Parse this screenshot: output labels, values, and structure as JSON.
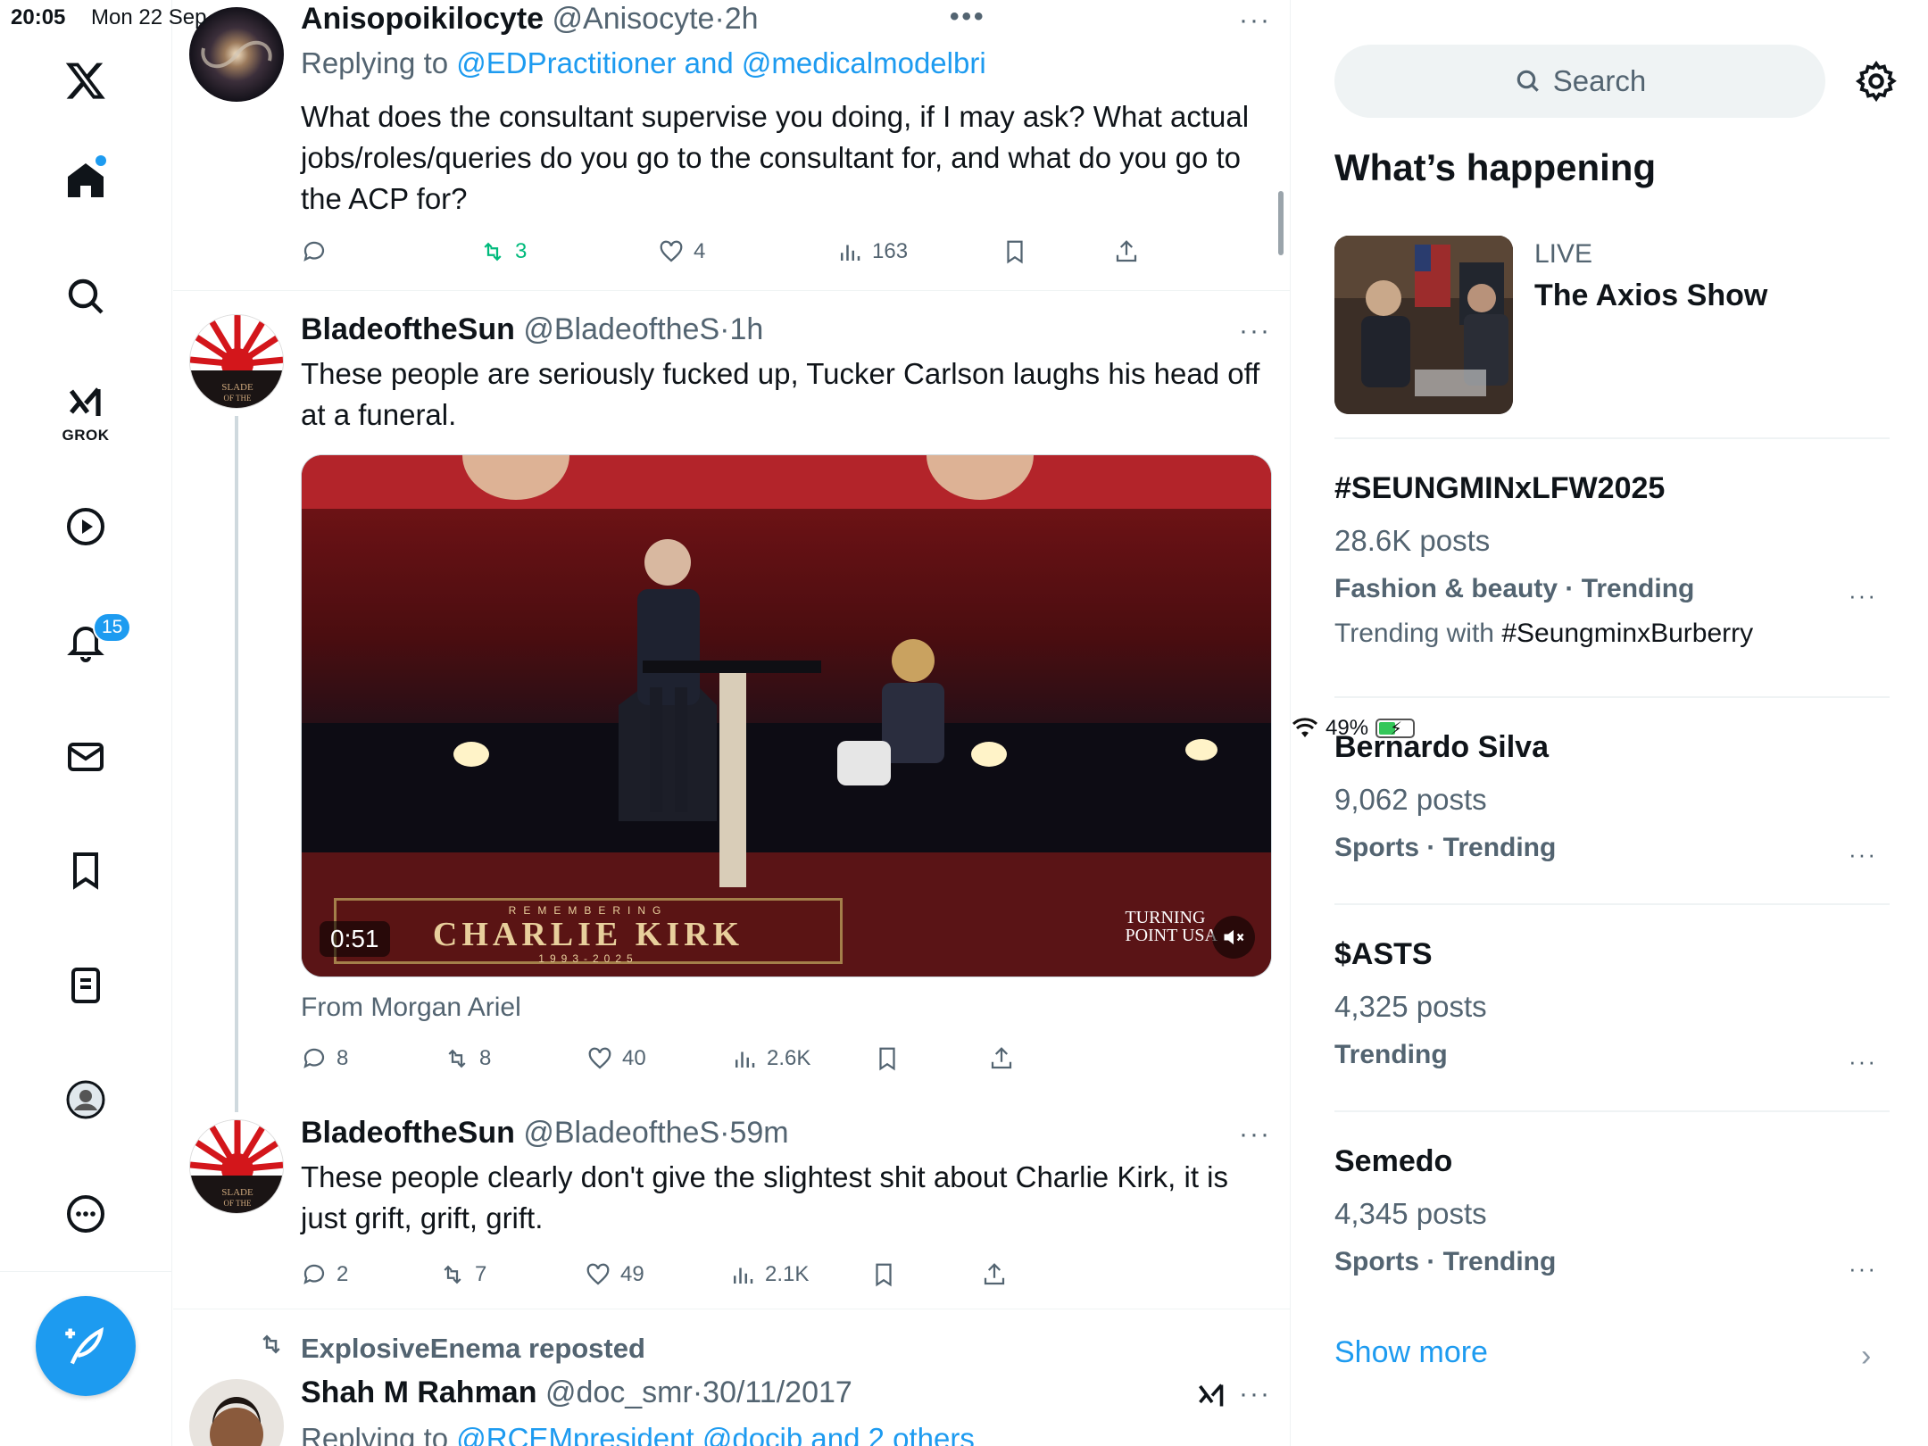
{
  "status_bar": {
    "time": "20:05",
    "date": "Mon 22 Sep",
    "battery": "49%"
  },
  "nav": {
    "grok_label": "GROK",
    "notifications_badge": "15"
  },
  "tweets": [
    {
      "name": "Anisopoikilocyte",
      "handle": "@Anisocyte",
      "time": "2h",
      "replying_prefix": "Replying to ",
      "replying_to": "@EDPractitioner and @medicalmodelbri",
      "text": "What does the consultant supervise you doing, if I may ask? What actual jobs/roles/queries do you go to the consultant for, and what do you go to the ACP for?",
      "replies": "",
      "reposts": "3",
      "likes": "4",
      "views": "163"
    },
    {
      "name": "BladeoftheSun",
      "handle": "@BladeoftheS",
      "time": "1h",
      "text": "These people are seriously fucked up, Tucker Carlson laughs his head off at a funeral.",
      "media": {
        "duration": "0:51",
        "banner_small": "REMEMBERING",
        "banner_big": "CHARLIE KIRK",
        "banner_years": "1993-2025",
        "logo_line1": "TURNING",
        "logo_line2": "POINT USA"
      },
      "media_source": "From Morgan Ariel",
      "replies": "8",
      "reposts": "8",
      "likes": "40",
      "views": "2.6K"
    },
    {
      "name": "BladeoftheSun",
      "handle": "@BladeoftheS",
      "time": "59m",
      "text": "These people clearly don't give the slightest shit about Charlie Kirk, it is just grift, grift, grift.",
      "replies": "2",
      "reposts": "7",
      "likes": "49",
      "views": "2.1K"
    },
    {
      "repost_label": "ExplosiveEnema reposted",
      "name": "Shah M Rahman",
      "handle": "@doc_smr",
      "time": "30/11/2017",
      "replying_prefix": "Replying to ",
      "replying_to": "@RCEMpresident @docjb and 2 others"
    }
  ],
  "sidebar": {
    "search_placeholder": "Search",
    "title": "What’s happening",
    "live": {
      "label": "LIVE",
      "name": "The Axios Show"
    },
    "trends": [
      {
        "name": "#SEUNGMINxLFW2025",
        "posts": "28.6K posts",
        "category": "Fashion & beauty · Trending",
        "with_prefix": "Trending with ",
        "with_tag": "#SeungminxBurberry"
      },
      {
        "name": "Bernardo Silva",
        "posts": "9,062 posts",
        "category": "Sports · Trending"
      },
      {
        "name": "$ASTS",
        "posts": "4,325 posts",
        "category": "Trending"
      },
      {
        "name": "Semedo",
        "posts": "4,345 posts",
        "category": "Sports · Trending"
      }
    ],
    "show_more": "Show more"
  },
  "colors": {
    "accent": "#1d9bf0",
    "text": "#0f1419",
    "muted": "#536471",
    "repost_green": "#00ba7c"
  }
}
